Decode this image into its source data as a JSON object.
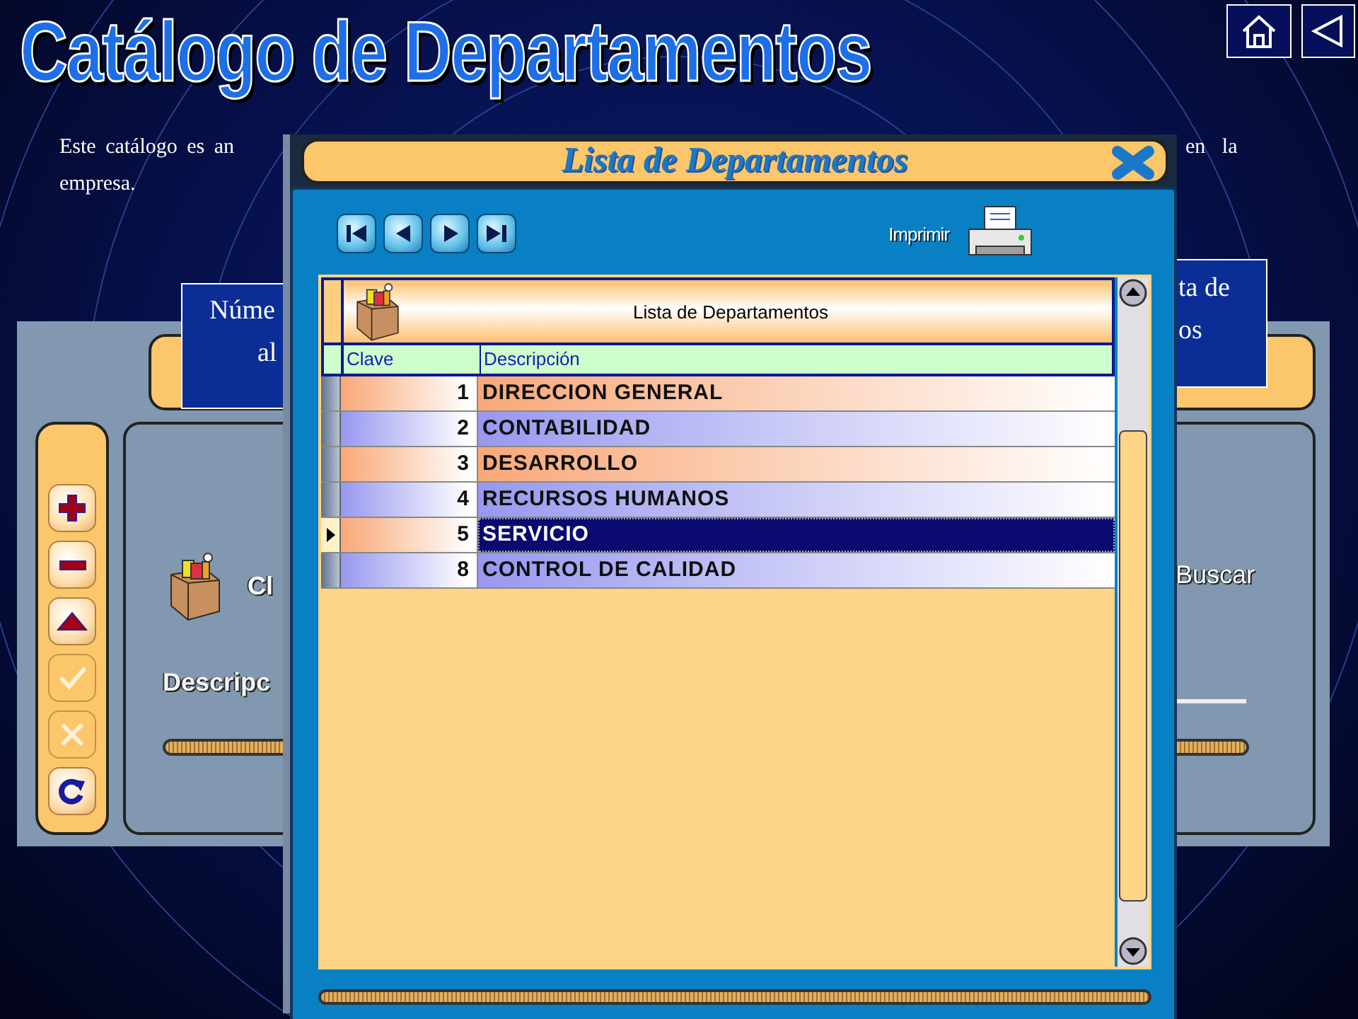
{
  "slide": {
    "title": "Catálogo de Departamentos",
    "nav": [
      {
        "kind": "home"
      },
      {
        "kind": "back"
      }
    ]
  },
  "intro": {
    "line_1_start": "Este catálogo es an",
    "line_1_end": "en la",
    "line_2": "empresa."
  },
  "callouts": [
    {
      "lines": [
        "Núme",
        "al"
      ]
    },
    {
      "lines": [
        "ta de",
        "os"
      ]
    }
  ],
  "background_window": {
    "toolbar": [
      {
        "kind": "add",
        "disabled": false
      },
      {
        "kind": "remove",
        "disabled": false
      },
      {
        "kind": "up",
        "disabled": false
      },
      {
        "kind": "check",
        "disabled": true
      },
      {
        "kind": "cancel",
        "disabled": true
      },
      {
        "kind": "refresh",
        "disabled": false
      }
    ],
    "key_label": "Cl",
    "description_label": "Descripc",
    "search_label": "Buscar"
  },
  "dialog": {
    "title": "Lista de Departamentos",
    "nav_buttons": [
      {
        "kind": "first"
      },
      {
        "kind": "previous"
      },
      {
        "kind": "next"
      },
      {
        "kind": "last"
      }
    ],
    "print_label": "Imprimir",
    "grid": {
      "caption": "Lista de Departamentos",
      "columns": [
        "Clave",
        "Descripción"
      ],
      "rows": [
        {
          "clave": "1",
          "descripcion": "DIRECCION GENERAL",
          "selected": false
        },
        {
          "clave": "2",
          "descripcion": "CONTABILIDAD",
          "selected": false
        },
        {
          "clave": "3",
          "descripcion": "DESARROLLO",
          "selected": false
        },
        {
          "clave": "4",
          "descripcion": "RECURSOS HUMANOS",
          "selected": false
        },
        {
          "clave": "5",
          "descripcion": "SERVICIO",
          "selected": true
        },
        {
          "clave": "8",
          "descripcion": "CONTROL DE CALIDAD",
          "selected": false
        }
      ]
    }
  }
}
